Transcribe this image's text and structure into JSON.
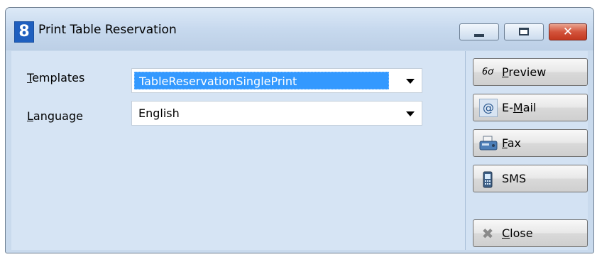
{
  "window": {
    "title": "Print Table Reservation",
    "app_icon_glyph": "8",
    "controls": {
      "minimize": "minimize-icon",
      "maximize": "maximize-icon",
      "close": "close-icon",
      "close_glyph": "✕"
    }
  },
  "form": {
    "templates": {
      "label_hotkey": "T",
      "label_rest": "emplates",
      "value": "TableReservationSinglePrint",
      "selected": true
    },
    "language": {
      "label_hotkey": "L",
      "label_rest": "anguage",
      "value": "English"
    }
  },
  "actions": [
    {
      "icon": "glasses-icon",
      "icon_glyph": "6ơ",
      "label_hotkey": "P",
      "label_rest": "review"
    },
    {
      "icon": "at-sign-icon",
      "icon_glyph": "@",
      "label_before": "E-",
      "label_hotkey": "M",
      "label_rest": "ail"
    },
    {
      "icon": "fax-icon",
      "label_hotkey": "F",
      "label_rest": "ax"
    },
    {
      "icon": "mobile-phone-icon",
      "label_text": "SMS"
    },
    {
      "icon": "close-x-icon",
      "icon_glyph": "✖",
      "label_hotkey": "C",
      "label_rest": "lose"
    }
  ],
  "colors": {
    "title_bar": "#c7d9ee",
    "selection": "#3399ff",
    "close_button": "#c3381f",
    "client": "#d3e2f3"
  }
}
